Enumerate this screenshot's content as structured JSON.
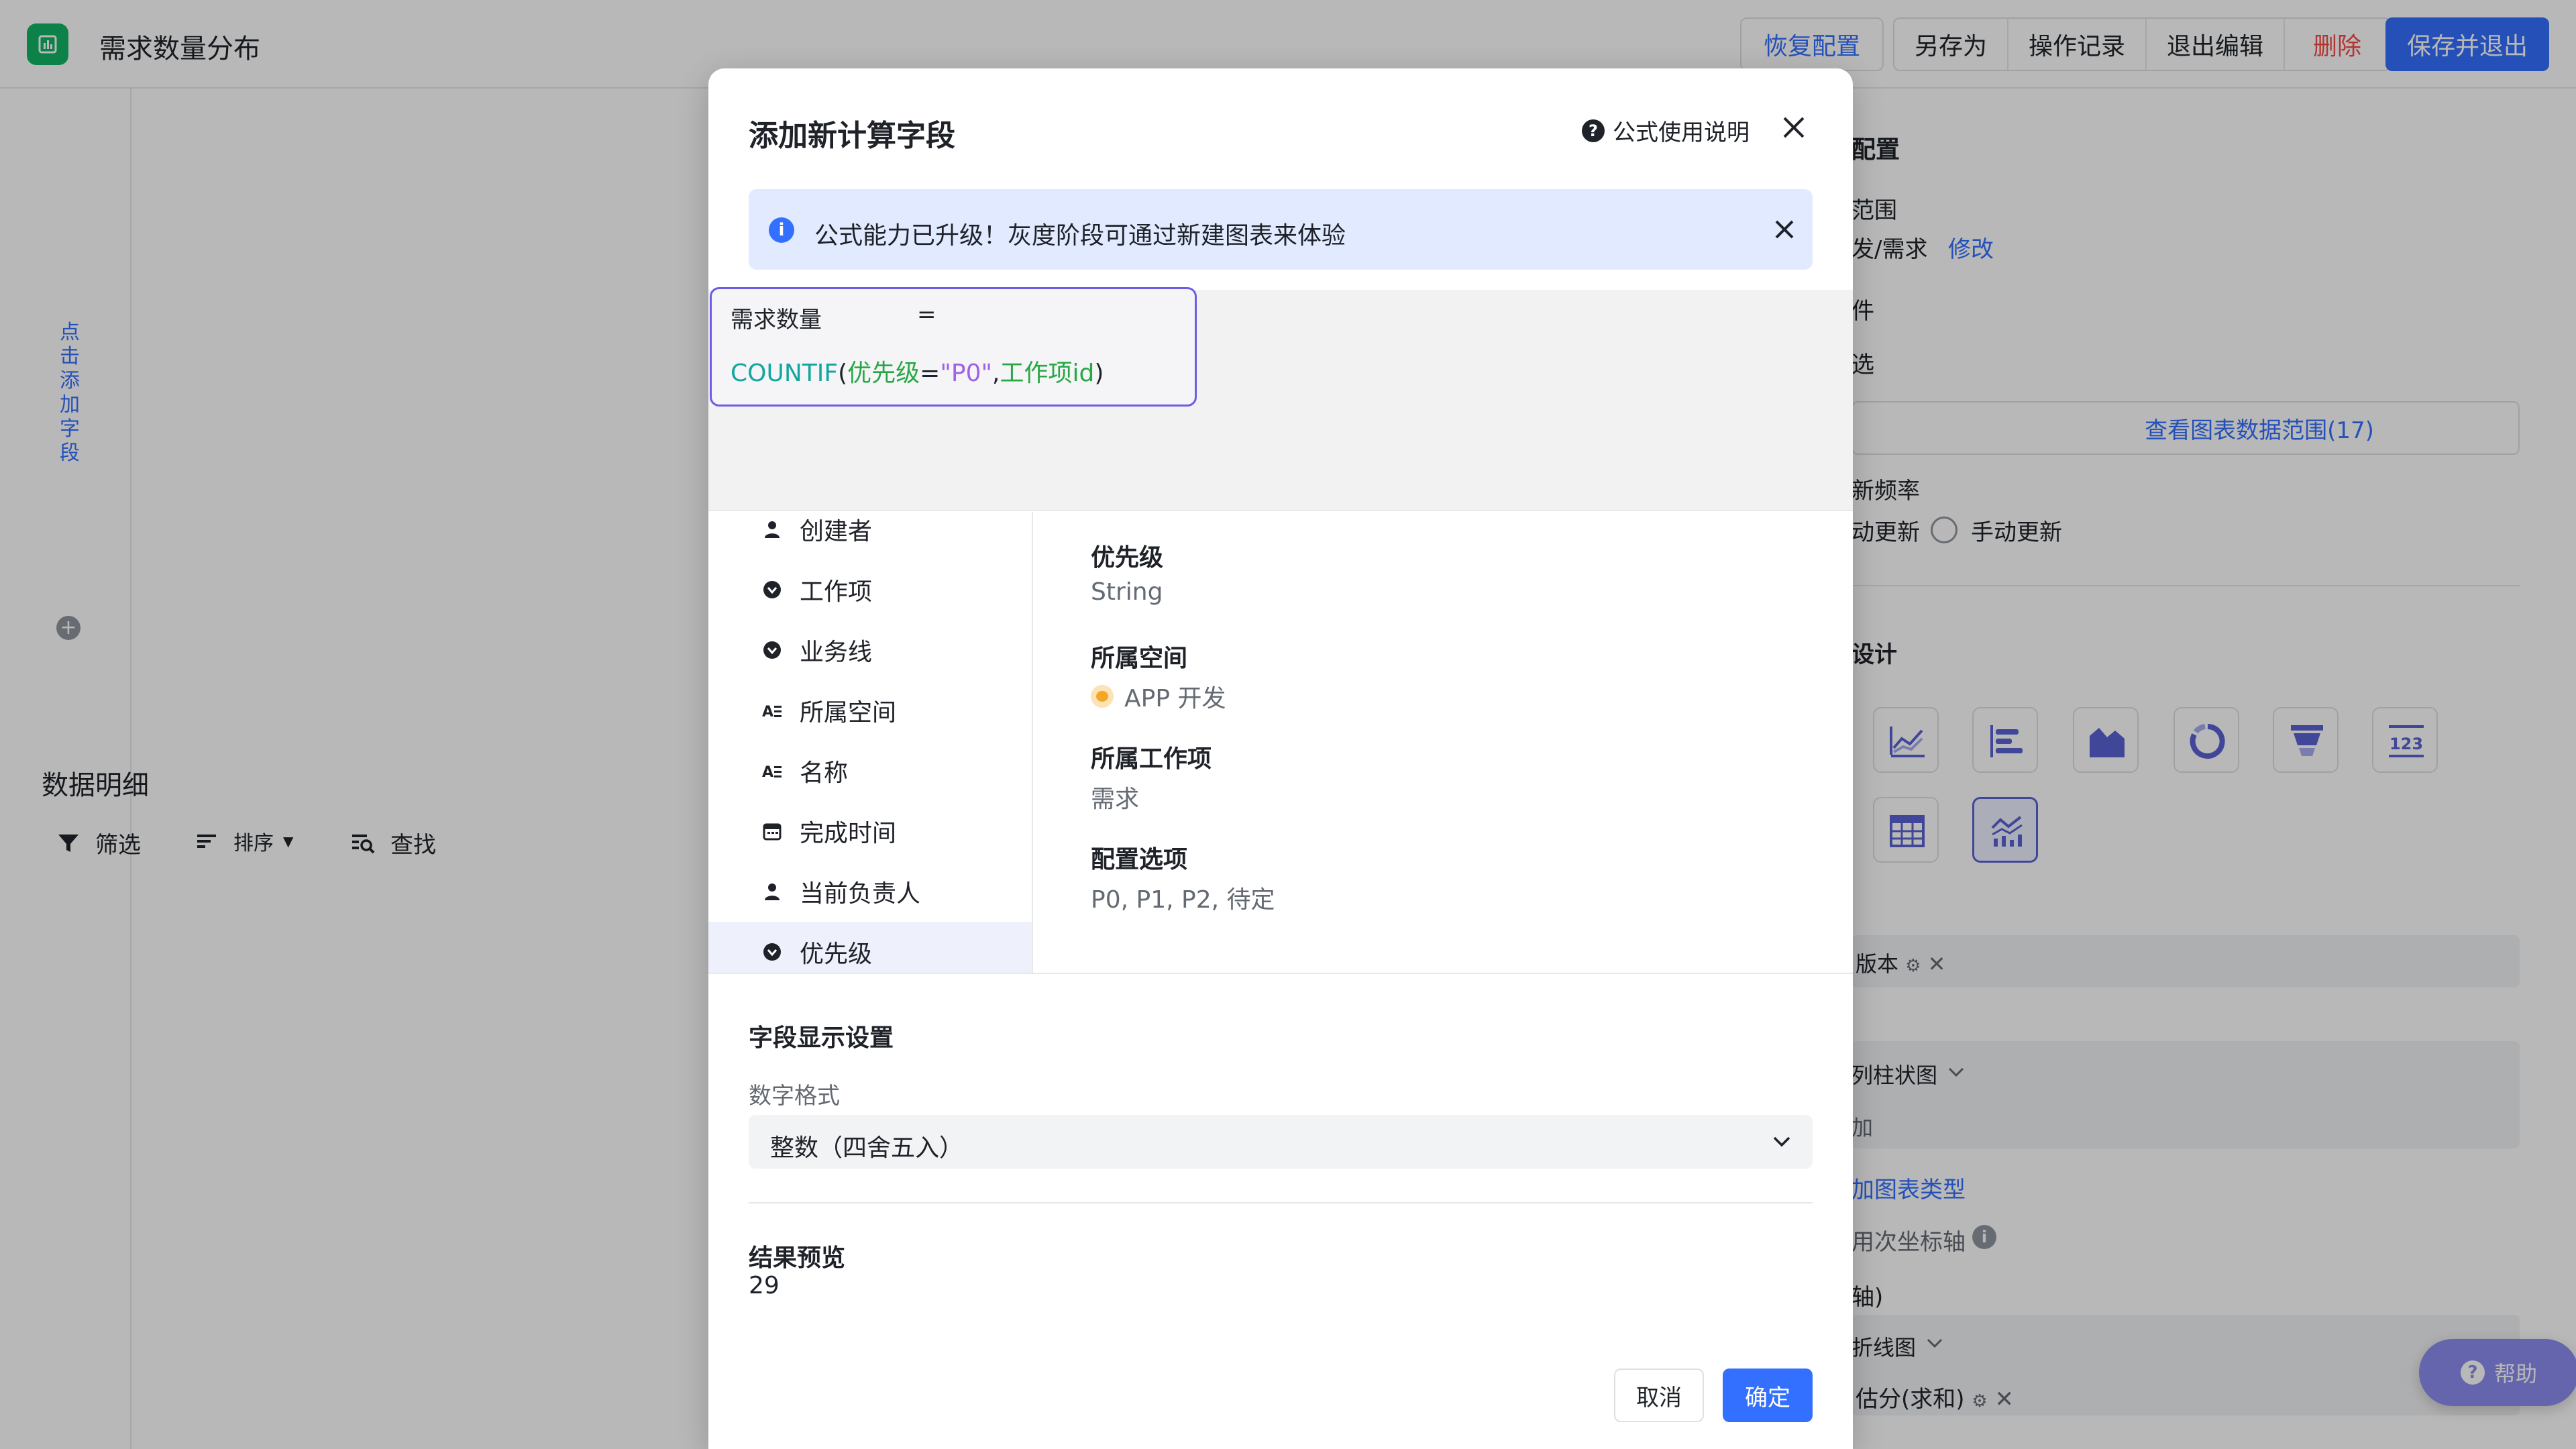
{
  "app": {
    "title": "需求数量分布",
    "restore_label": "恢复配置",
    "save_as_label": "另存为",
    "history_label": "操作记录",
    "exit_edit_label": "退出编辑",
    "delete_label": "删除",
    "save_exit_label": "保存并退出",
    "add_field_vertical": "点击添加字段",
    "detail_title": "数据明细",
    "tools": {
      "filter": "筛选",
      "sort": "排序",
      "find": "查找"
    },
    "help_label": "帮助"
  },
  "config_panel": {
    "section_title_fragment": "配置",
    "range_label_fragment": "范围",
    "range_value_fragment": "发/需求",
    "modify_link": "修改",
    "condition_label_fragment": "件",
    "condition_value_fragment": "选",
    "view_range_button": "查看图表数据范围(17)",
    "update_freq_fragment": "新频率",
    "auto_update_fragment": "动更新",
    "manual_update": "手动更新",
    "design_fragment": "设计",
    "version_tag_fragment": "版本",
    "bar_chart_fragment": "列柱状图",
    "add_fragment": "加",
    "chart_type_link_fragment": "加图表类型",
    "secondary_axis_fragment": "用次坐标轴",
    "axis_fragment": "轴)",
    "line_chart_fragment": "折线图",
    "estimate_tag_fragment": "估分(求和)"
  },
  "modal": {
    "title": "添加新计算字段",
    "formula_help": "公式使用说明",
    "notice": "公式能力已升级！灰度阶段可通过新建图表来体验",
    "field_name": "需求数量",
    "equals": "=",
    "formula": {
      "fn": "COUNTIF",
      "open": "(",
      "field1": "优先级",
      "op": "=",
      "str": "\"P0\"",
      "comma": ",",
      "field2": "工作项id",
      "close": ")"
    },
    "fields": [
      {
        "label": "创建者",
        "icon": "person-icon"
      },
      {
        "label": "工作项",
        "icon": "select-icon"
      },
      {
        "label": "业务线",
        "icon": "select-icon"
      },
      {
        "label": "所属空间",
        "icon": "text-icon"
      },
      {
        "label": "名称",
        "icon": "text-icon"
      },
      {
        "label": "完成时间",
        "icon": "calendar-icon"
      },
      {
        "label": "当前负责人",
        "icon": "person-icon"
      },
      {
        "label": "优先级",
        "icon": "select-icon",
        "selected": true
      }
    ],
    "field_detail": {
      "name_label": "优先级",
      "type_value": "String",
      "space_label": "所属空间",
      "space_value": "APP 开发",
      "workitem_label": "所属工作项",
      "workitem_value": "需求",
      "options_label": "配置选项",
      "options_value": "P0, P1, P2, 待定"
    },
    "display_settings_title": "字段显示设置",
    "number_format_label": "数字格式",
    "number_format_value": "整数（四舍五入）",
    "preview_label": "结果预览",
    "preview_value": "29",
    "cancel_label": "取消",
    "confirm_label": "确定"
  }
}
